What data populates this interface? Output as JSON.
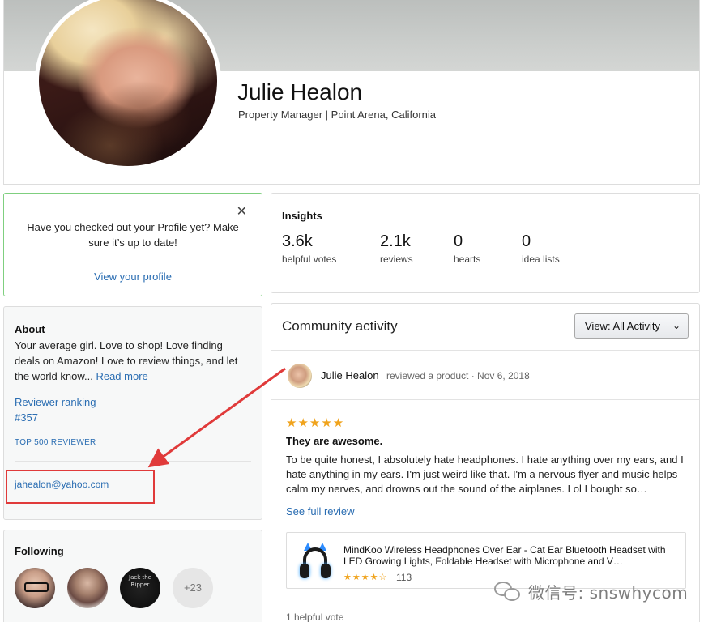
{
  "profile": {
    "name": "Julie Healon",
    "subtitle": "Property Manager | Point Arena, California"
  },
  "notice": {
    "message": "Have you checked out your Profile yet? Make sure it’s up to date!",
    "link": "View your profile",
    "close_icon": "close-icon"
  },
  "about": {
    "title": "About",
    "bio": "Your average girl. Love to shop! Love finding deals on Amazon! Love to review things, and let the world know...",
    "read_more": "Read more",
    "ranking_label": "Reviewer ranking",
    "ranking_value": "#357",
    "badge": "TOP 500 REVIEWER",
    "email": "jahealon@yahoo.com"
  },
  "following": {
    "title": "Following",
    "fav3_text": "Jack the Ripper",
    "more": "+23"
  },
  "insights": {
    "title": "Insights",
    "stats": [
      {
        "value": "3.6k",
        "label": "helpful votes"
      },
      {
        "value": "2.1k",
        "label": "reviews"
      },
      {
        "value": "0",
        "label": "hearts"
      },
      {
        "value": "0",
        "label": "idea lists"
      }
    ]
  },
  "community": {
    "title": "Community activity",
    "view_label": "View:  All Activity",
    "entry": {
      "name": "Julie Healon",
      "meta": "reviewed a product · Nov 6, 2018",
      "rating": "★★★★★",
      "rating_value": 5,
      "title": "They are awesome.",
      "body": "To be quite honest, I absolutely hate headphones. I hate anything over my ears, and I hate anything in my ears. I'm just weird like that. I'm a nervous flyer and music helps calm my nerves, and drowns out the sound of the airplanes. Lol I bought so…",
      "see_full": "See full review",
      "product": {
        "title": "MindKoo Wireless Headphones Over Ear - Cat Ear Bluetooth Headset with LED Growing Lights, Foldable Headset with Microphone and V…",
        "stars": "★★★★☆",
        "rating_value": 4,
        "count": "113"
      },
      "helpful": "1 helpful vote"
    }
  },
  "watermark": "微信号: snswhycom",
  "colors": {
    "link": "#2a6db2",
    "star": "#f0a31c",
    "annotation": "#e03a3a",
    "notice_border": "#7fcf7f"
  }
}
